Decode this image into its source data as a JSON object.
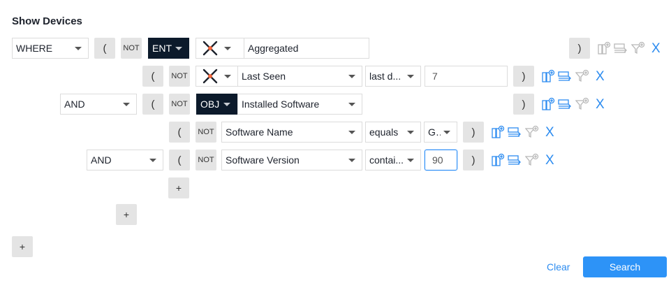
{
  "title": "Show Devices",
  "colors": {
    "accent": "#2d8cf0",
    "dark_tag": "#0c1a2b",
    "logo_orange": "#f2683f"
  },
  "icons": [
    "add-expression-icon",
    "obj-icon",
    "filter-outdated-icon",
    "remove-icon"
  ],
  "rows": [
    {
      "logic": "WHERE",
      "open_paren": "(",
      "not_label": "NOT",
      "context": "ENT",
      "entity_label": "Aggregated",
      "close_paren": ")",
      "remove": "X"
    },
    {
      "open_paren": "(",
      "not_label": "NOT",
      "field": "Last Seen",
      "operator": "last d...",
      "value": "7",
      "close_paren": ")",
      "remove": "X"
    },
    {
      "logic": "AND",
      "open_paren": "(",
      "not_label": "NOT",
      "context": "OBJ",
      "field": "Installed Software",
      "close_paren": ")",
      "remove": "X"
    },
    {
      "open_paren": "(",
      "not_label": "NOT",
      "field": "Software Name",
      "operator": "equals",
      "value": "G...",
      "close_paren": ")",
      "remove": "X"
    },
    {
      "logic": "AND",
      "open_paren": "(",
      "not_label": "NOT",
      "field": "Software Version",
      "operator": "contai...",
      "value": "90",
      "close_paren": ")",
      "remove": "X"
    }
  ],
  "add_labels": {
    "nested": "+",
    "obj": "+",
    "main": "+"
  },
  "footer": {
    "clear": "Clear",
    "search": "Search"
  }
}
